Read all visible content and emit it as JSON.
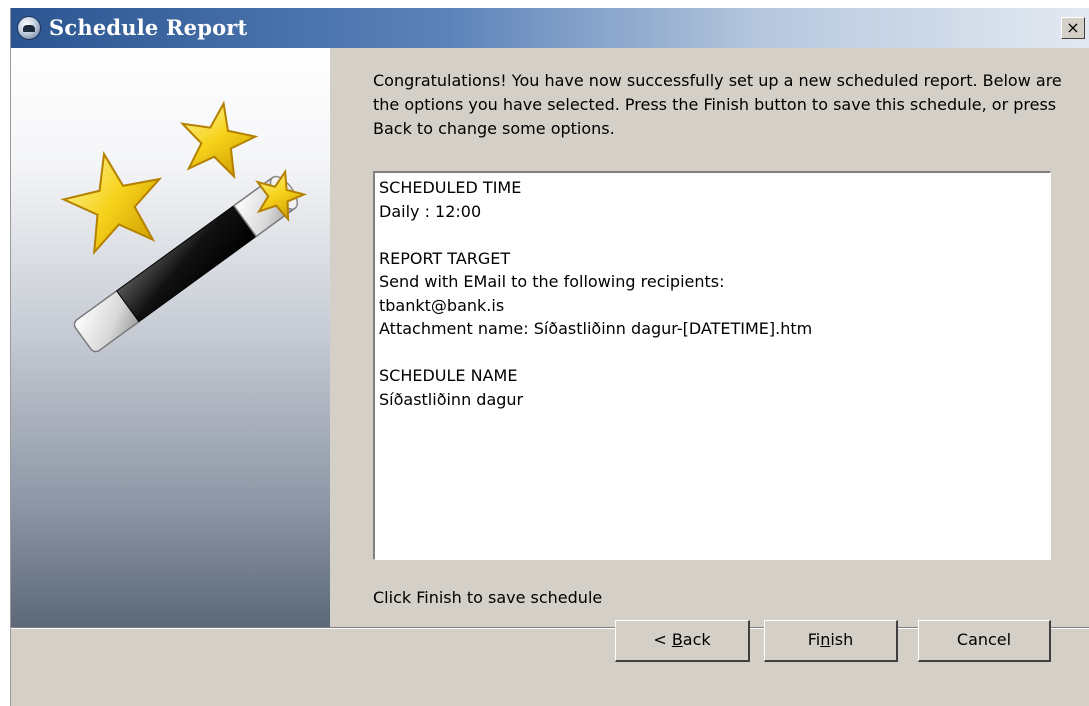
{
  "window": {
    "title": "Schedule Report",
    "close_label": "×"
  },
  "intro_text": "Congratulations!  You have now successfully set up a new scheduled report.  Below are the options you have selected.  Press the Finish button to save this schedule, or press Back to change some options.",
  "summary": {
    "lines": [
      "SCHEDULED TIME",
      "Daily : 12:00",
      "",
      "REPORT TARGET",
      "Send with EMail to the following recipients:",
      "tbankt@bank.is",
      "Attachment name: Síðastliðinn dagur-[DATETIME].htm",
      "",
      "SCHEDULE NAME",
      "Síðastliðinn dagur"
    ]
  },
  "footer_hint": "Click Finish to save schedule",
  "buttons": {
    "back": {
      "pre": "< ",
      "mnemonic": "B",
      "post": "ack"
    },
    "finish": {
      "pre": "Fi",
      "mnemonic": "n",
      "post": "ish"
    },
    "cancel": {
      "label": "Cancel"
    }
  },
  "icons": {
    "title_icon": "schedule-report-icon",
    "wizard_art": "magic-wand-stars-icon"
  }
}
